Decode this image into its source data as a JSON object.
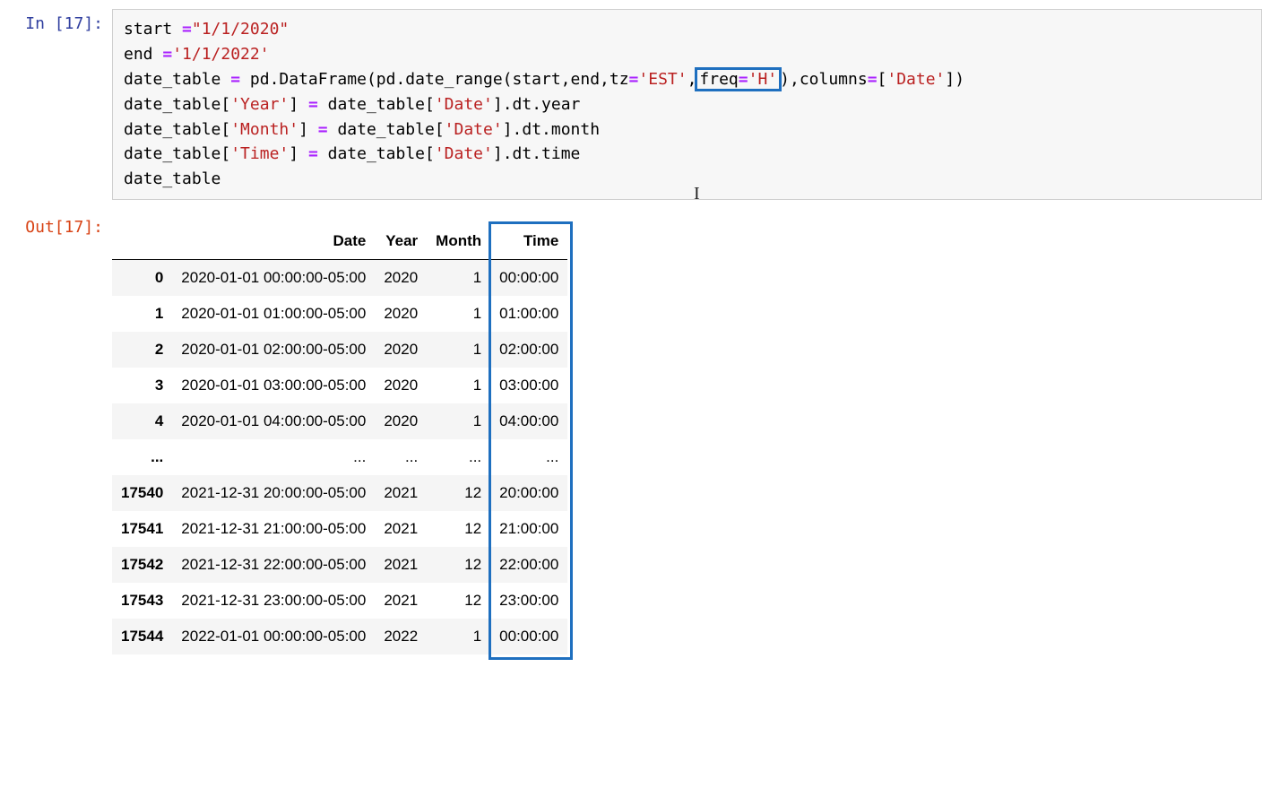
{
  "input": {
    "prompt": "In [17]:",
    "code": {
      "l1a": "start ",
      "l1b": "=",
      "l1c": "\"1/1/2020\"",
      "l2a": "end ",
      "l2b": "=",
      "l2c": "'1/1/2022'",
      "l3a": "date_table ",
      "l3b": "=",
      "l3c": " pd.DataFrame(pd.date_range(start,end,tz",
      "l3d": "=",
      "l3e": "'EST'",
      "l3f": ",",
      "l3g_hi": "freq",
      "l3h_hi": "=",
      "l3i_hi": "'H'",
      "l3j": "),columns",
      "l3k": "=",
      "l3l": "[",
      "l3m": "'Date'",
      "l3n": "])",
      "l4a": "date_table[",
      "l4b": "'Year'",
      "l4c": "] ",
      "l4d": "=",
      "l4e": " date_table[",
      "l4f": "'Date'",
      "l4g": "].dt.year",
      "l5a": "date_table[",
      "l5b": "'Month'",
      "l5c": "] ",
      "l5d": "=",
      "l5e": " date_table[",
      "l5f": "'Date'",
      "l5g": "].dt.month",
      "l6a": "date_table[",
      "l6b": "'Time'",
      "l6c": "] ",
      "l6d": "=",
      "l6e": " date_table[",
      "l6f": "'Date'",
      "l6g": "].dt.time",
      "l7": "date_table"
    }
  },
  "output": {
    "prompt": "Out[17]:",
    "columns": [
      "Date",
      "Year",
      "Month",
      "Time"
    ],
    "highlight_column": "Time",
    "rows": [
      {
        "idx": "0",
        "Date": "2020-01-01 00:00:00-05:00",
        "Year": "2020",
        "Month": "1",
        "Time": "00:00:00"
      },
      {
        "idx": "1",
        "Date": "2020-01-01 01:00:00-05:00",
        "Year": "2020",
        "Month": "1",
        "Time": "01:00:00"
      },
      {
        "idx": "2",
        "Date": "2020-01-01 02:00:00-05:00",
        "Year": "2020",
        "Month": "1",
        "Time": "02:00:00"
      },
      {
        "idx": "3",
        "Date": "2020-01-01 03:00:00-05:00",
        "Year": "2020",
        "Month": "1",
        "Time": "03:00:00"
      },
      {
        "idx": "4",
        "Date": "2020-01-01 04:00:00-05:00",
        "Year": "2020",
        "Month": "1",
        "Time": "04:00:00"
      },
      {
        "idx": "...",
        "Date": "...",
        "Year": "...",
        "Month": "...",
        "Time": "..."
      },
      {
        "idx": "17540",
        "Date": "2021-12-31 20:00:00-05:00",
        "Year": "2021",
        "Month": "12",
        "Time": "20:00:00"
      },
      {
        "idx": "17541",
        "Date": "2021-12-31 21:00:00-05:00",
        "Year": "2021",
        "Month": "12",
        "Time": "21:00:00"
      },
      {
        "idx": "17542",
        "Date": "2021-12-31 22:00:00-05:00",
        "Year": "2021",
        "Month": "12",
        "Time": "22:00:00"
      },
      {
        "idx": "17543",
        "Date": "2021-12-31 23:00:00-05:00",
        "Year": "2021",
        "Month": "12",
        "Time": "23:00:00"
      },
      {
        "idx": "17544",
        "Date": "2022-01-01 00:00:00-05:00",
        "Year": "2022",
        "Month": "1",
        "Time": "00:00:00"
      }
    ]
  },
  "annotations": {
    "code_highlight": "freq='H'",
    "highlight_color": "#1E6FBF"
  }
}
